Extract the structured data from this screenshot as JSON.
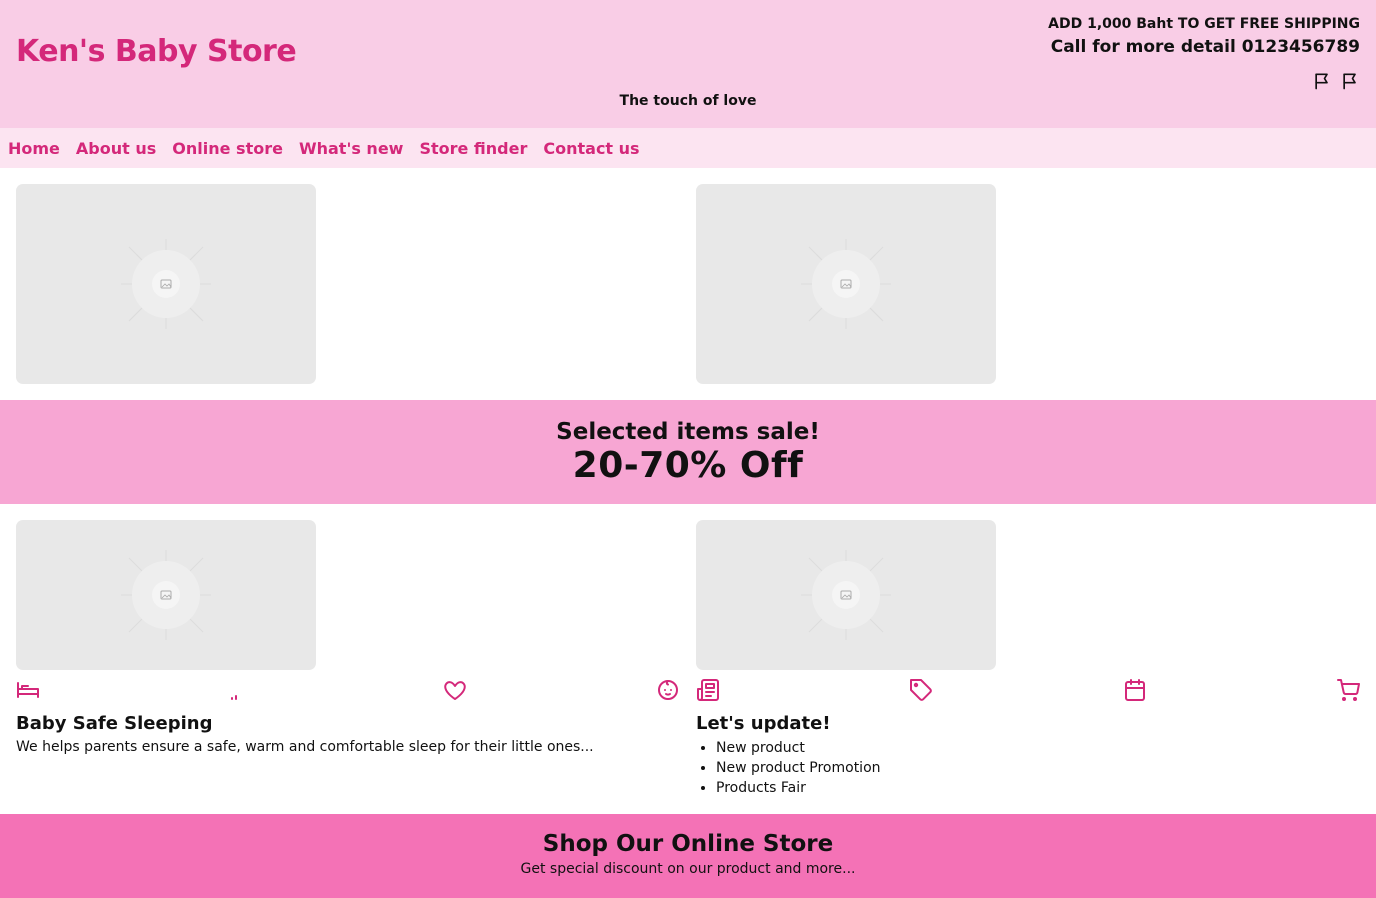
{
  "header": {
    "brand": "Ken's Baby Store",
    "tagline": "The touch of love",
    "promo_shipping": "ADD 1,000 Baht TO GET FREE SHIPPING",
    "promo_phone": "Call for more detail 0123456789",
    "flags": [
      "flag-icon",
      "flag-icon"
    ]
  },
  "nav": {
    "items": [
      "Home",
      "About us",
      "Online store",
      "What's new",
      "Store finder",
      "Contact us"
    ]
  },
  "sale": {
    "title": "Selected items sale!",
    "percent": "20-70% Off"
  },
  "sleeping_card": {
    "title": "Baby Safe Sleeping",
    "text": "We helps parents ensure a safe, warm and comfortable sleep for their little ones...",
    "icons": [
      "bed-icon",
      "signal-icon",
      "heart-icon",
      "baby-icon"
    ]
  },
  "update_card": {
    "title": "Let's update!",
    "items": [
      "New product",
      "New product Promotion",
      "Products Fair"
    ],
    "icons": [
      "newspaper-icon",
      "tag-icon",
      "calendar-icon",
      "cart-icon"
    ]
  },
  "footer": {
    "title": "Shop Our Online Store",
    "subtitle": "Get special discount on our product and more..."
  },
  "colors": {
    "header_bg": "#f9cde6",
    "nav_bg": "#fce4f1",
    "brand": "#d4287a",
    "sale_bg": "#f7a6d3",
    "footer_bg": "#f472b6",
    "placeholder": "#e8e8e8"
  }
}
